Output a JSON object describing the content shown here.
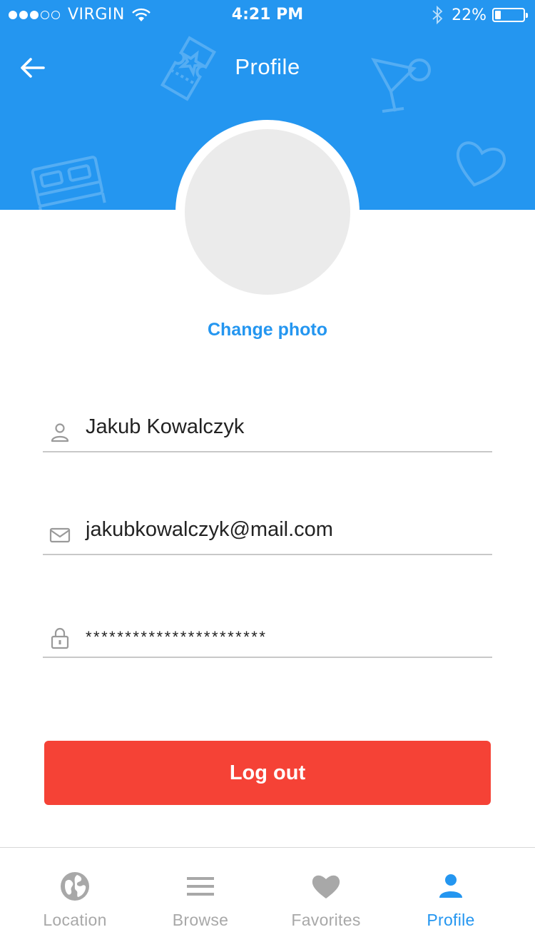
{
  "status_bar": {
    "carrier": "VIRGIN",
    "time": "4:21 PM",
    "battery_percent": "22%",
    "battery_level": 0.22,
    "signal_bars": 3,
    "signal_total": 5
  },
  "header": {
    "title": "Profile",
    "background_color": "#2496f0",
    "decorative_icons": [
      "ticket-icon",
      "cocktail-icon",
      "bed-icon",
      "heart-icon"
    ]
  },
  "profile": {
    "change_photo_label": "Change photo"
  },
  "fields": {
    "name": {
      "icon": "person-icon",
      "value": "Jakub Kowalczyk"
    },
    "email": {
      "icon": "mail-icon",
      "value": "jakubkowalczyk@mail.com"
    },
    "password": {
      "icon": "lock-icon",
      "value": "***********************"
    }
  },
  "logout": {
    "label": "Log out",
    "color": "#f54236"
  },
  "tabs": [
    {
      "label": "Location",
      "icon": "globe-icon",
      "active": false
    },
    {
      "label": "Browse",
      "icon": "menu-icon",
      "active": false
    },
    {
      "label": "Favorites",
      "icon": "heart-icon",
      "active": false
    },
    {
      "label": "Profile",
      "icon": "person-icon",
      "active": true
    }
  ],
  "colors": {
    "accent": "#2496f0",
    "danger": "#f54236",
    "inactive": "#a8a8a8"
  }
}
